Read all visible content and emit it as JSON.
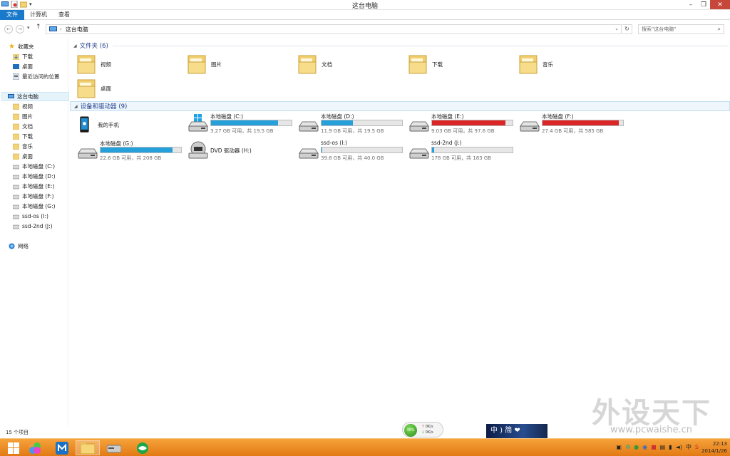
{
  "window": {
    "title": "这台电脑"
  },
  "ribbon": {
    "tabs": [
      "文件",
      "计算机",
      "查看"
    ]
  },
  "address": {
    "crumb": "这台电脑",
    "search_placeholder": "搜索\"这台电脑\""
  },
  "nav": {
    "favorites_header": "收藏夹",
    "favorites": [
      "下载",
      "桌面",
      "最近访问的位置"
    ],
    "thispc_header": "这台电脑",
    "thispc_items": [
      "视频",
      "图片",
      "文档",
      "下载",
      "音乐",
      "桌面",
      "本地磁盘 (C:)",
      "本地磁盘 (D:)",
      "本地磁盘 (E:)",
      "本地磁盘 (F:)",
      "本地磁盘 (G:)",
      "ssd-os (I:)",
      "ssd-2nd (J:)"
    ],
    "network": "网络"
  },
  "folders_group": {
    "title": "文件夹 (6)"
  },
  "folders": [
    "视频",
    "图片",
    "文档",
    "下载",
    "音乐",
    "桌面"
  ],
  "devices_group": {
    "title": "设备和驱动器 (9)"
  },
  "phone": {
    "name": "我的手机"
  },
  "drives": [
    {
      "name": "本地磁盘 (C:)",
      "size": "3.27 GB 可用，共 19.5 GB",
      "used_fraction": 0.83,
      "color": "#26a0da"
    },
    {
      "name": "本地磁盘 (D:)",
      "size": "11.9 GB 可用，共 19.5 GB",
      "used_fraction": 0.39,
      "color": "#26a0da"
    },
    {
      "name": "本地磁盘 (E:)",
      "size": "9.03 GB 可用，共 97.6 GB",
      "used_fraction": 0.91,
      "color": "#da2626"
    },
    {
      "name": "本地磁盘 (F:)",
      "size": "27.4 GB 可用，共 585 GB",
      "used_fraction": 0.95,
      "color": "#da2626"
    },
    {
      "name": "本地磁盘 (G:)",
      "size": "22.6 GB 可用，共 208 GB",
      "used_fraction": 0.89,
      "color": "#26a0da"
    },
    {
      "name": "DVD 驱动器 (H:)",
      "size": "",
      "used_fraction": null,
      "color": ""
    },
    {
      "name": "ssd-os (I:)",
      "size": "39.8 GB 可用，共 40.0 GB",
      "used_fraction": 0.005,
      "color": "#26a0da"
    },
    {
      "name": "ssd-2nd (J:)",
      "size": "178 GB 可用，共 183 GB",
      "used_fraction": 0.03,
      "color": "#26a0da"
    }
  ],
  "status": {
    "items_count": "15 个项目"
  },
  "speed": {
    "percent": "30%",
    "up": "0K/s",
    "down": "0K/s"
  },
  "ime": {
    "text": "中 ) 简 ❤"
  },
  "watermark": {
    "big": "外设天下",
    "url": "www.pcwaishe.cn"
  },
  "tray": {
    "ime_char": "中"
  },
  "clock": {
    "time": "22:13",
    "date": "2014/1/26"
  }
}
